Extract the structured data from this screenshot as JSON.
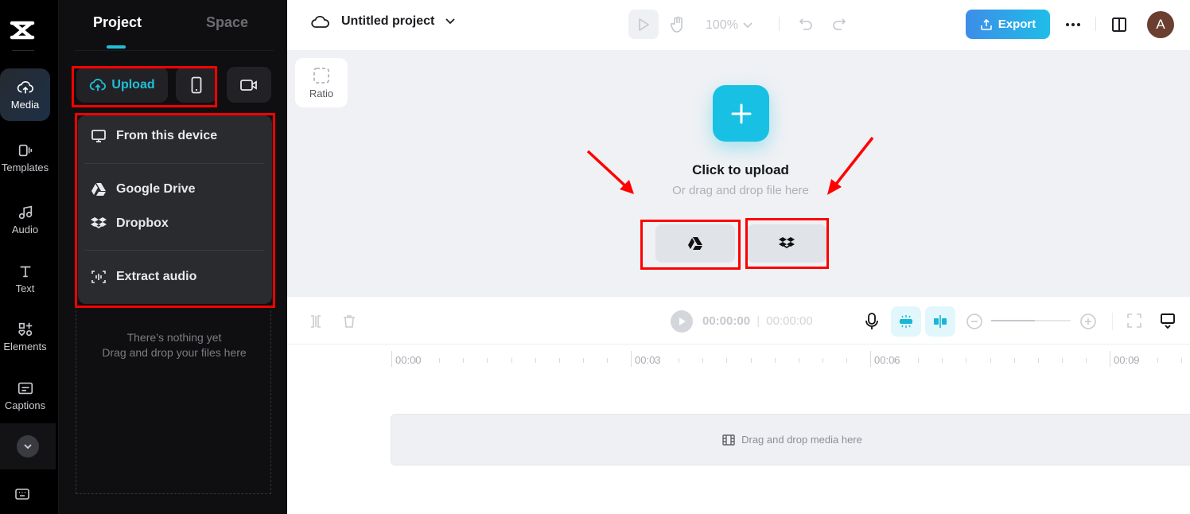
{
  "rail": {
    "items": [
      {
        "label": "Media",
        "icon": "cloud-upload-icon",
        "active": true
      },
      {
        "label": "Templates",
        "icon": "templates-icon"
      },
      {
        "label": "Audio",
        "icon": "music-note-icon"
      },
      {
        "label": "Text",
        "icon": "text-icon"
      },
      {
        "label": "Elements",
        "icon": "elements-icon"
      },
      {
        "label": "Captions",
        "icon": "captions-icon"
      }
    ]
  },
  "panel": {
    "tabs": [
      {
        "label": "Project",
        "active": true
      },
      {
        "label": "Space"
      }
    ],
    "upload_label": "Upload",
    "menu": [
      {
        "label": "From this device",
        "icon": "monitor-icon"
      },
      {
        "label": "Google Drive",
        "icon": "google-drive-icon"
      },
      {
        "label": "Dropbox",
        "icon": "dropbox-icon"
      },
      {
        "label": "Extract audio",
        "icon": "extract-audio-icon"
      }
    ],
    "empty_line1": "There’s nothing yet",
    "empty_line2": "Drag and drop your files here"
  },
  "topbar": {
    "project_title": "Untitled project",
    "zoom": "100%",
    "export_label": "Export",
    "avatar_initial": "A"
  },
  "canvas": {
    "ratio_label": "Ratio",
    "click_to_upload": "Click to upload",
    "drag_drop": "Or drag and drop file here"
  },
  "timeline": {
    "current_time": "00:00:00",
    "total_time": "00:00:00",
    "zoom_fraction": 0.55,
    "ruler_labels": [
      "00:00",
      "00:03",
      "00:06",
      "00:09"
    ],
    "track_placeholder": "Drag and drop media here"
  },
  "colors": {
    "accent": "#1fc0d8",
    "highlight": "#ff0000",
    "export_start": "#3d8de8",
    "export_end": "#1fbde8"
  }
}
